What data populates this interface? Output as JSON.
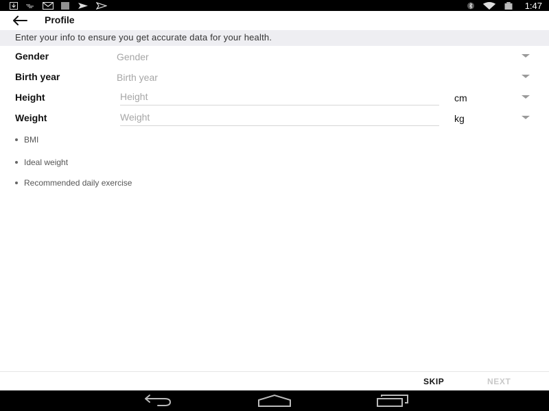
{
  "status_bar": {
    "time": "1:47",
    "left_icons": [
      "download-icon",
      "notification-icon",
      "gmail-icon",
      "barcode-icon",
      "send-icon",
      "send-outline-icon"
    ],
    "right_icons": [
      "bluetooth-icon",
      "wifi-icon",
      "battery-icon"
    ]
  },
  "app_bar": {
    "title": "Profile",
    "back_icon": "arrow-back-icon"
  },
  "banner": {
    "text": "Enter your info to ensure you get accurate data for your health."
  },
  "form": {
    "gender": {
      "label": "Gender",
      "placeholder": "Gender"
    },
    "birth_year": {
      "label": "Birth year",
      "placeholder": "Birth year"
    },
    "height": {
      "label": "Height",
      "placeholder": "Height",
      "value": "",
      "unit": "cm"
    },
    "weight": {
      "label": "Weight",
      "placeholder": "Weight",
      "value": "",
      "unit": "kg"
    }
  },
  "info_items": [
    "BMI",
    "Ideal weight",
    "Recommended daily exercise"
  ],
  "actions": {
    "skip": "SKIP",
    "next": "NEXT"
  },
  "nav_bar": {
    "icons": [
      "back-nav-icon",
      "home-nav-icon",
      "recents-nav-icon"
    ]
  },
  "colors": {
    "status_bar_bg": "#000000",
    "banner_bg": "#eeeef2",
    "placeholder": "#a6a6a6",
    "disabled_text": "#c9c9c9"
  }
}
